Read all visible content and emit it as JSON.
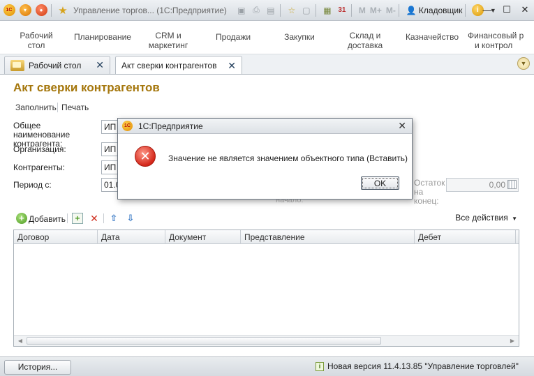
{
  "window": {
    "title": "Управление торгов...  (1С:Предприятие)",
    "user": "Кладовщик",
    "m_buttons": [
      "M",
      "M+",
      "M-"
    ],
    "calendar_day": "31"
  },
  "sections": [
    {
      "label": "Рабочий стол"
    },
    {
      "label": "Планирование"
    },
    {
      "label": "CRM и маркетинг"
    },
    {
      "label": "Продажи"
    },
    {
      "label": "Закупки"
    },
    {
      "label": "Склад и доставка"
    },
    {
      "label": "Казначейство"
    },
    {
      "label": "Финансовый р... и контрол..."
    }
  ],
  "tabs": [
    {
      "label": "Рабочий стол",
      "active": false
    },
    {
      "label": "Акт сверки контрагентов",
      "active": true
    }
  ],
  "form": {
    "title": "Акт сверки контрагентов",
    "commands": {
      "fill": "Заполнить",
      "print": "Печать"
    },
    "fields": {
      "counterparty_name_label": "Общее наименование контрагента:",
      "counterparty_name_value": "ИП",
      "organization_label": "Организация:",
      "organization_value": "ИП",
      "counterparties_label": "Контрагенты:",
      "counterparties_value": "ИП",
      "period_label": "Период с:",
      "period_value": "01.0"
    },
    "balance": {
      "label_line1": "Остаток",
      "label_line2": "на",
      "label_line3": "конец:",
      "value": "0,00",
      "ghost_text": "начало:"
    },
    "grid_toolbar": {
      "add": "Добавить",
      "all_actions": "Все действия"
    },
    "table": {
      "columns": [
        "Договор",
        "Дата",
        "Документ",
        "Представление",
        "Дебет"
      ],
      "rows": []
    }
  },
  "statusbar": {
    "history": "История...",
    "info": "Новая версия 11.4.13.85 \"Управление торговлей\""
  },
  "dialog": {
    "title": "1С:Предприятие",
    "message": "Значение не является значением объектного типа (Вставить)",
    "ok": "OK"
  },
  "colors": {
    "title_accent": "#a5770d",
    "error_red": "#d4271a"
  }
}
